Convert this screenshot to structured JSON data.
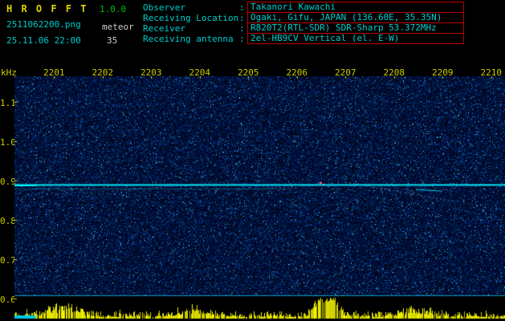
{
  "app": {
    "title": "H R O F F T",
    "version": "1.0.0",
    "filename": "2511062200.png",
    "mode": "meteor",
    "datetime": "25.11.06 22:00",
    "count": "35"
  },
  "info": {
    "rows": [
      {
        "label": "Observer",
        "value": "Takanori Kawachi"
      },
      {
        "label": "Receiving Location",
        "value": "Ogaki, Gifu, JAPAN (136.60E, 35.35N)"
      },
      {
        "label": "Receiver",
        "value": "R820T2(RTL-SDR) SDR-Sharp 53.372MHz"
      },
      {
        "label": "Receiving antenna",
        "value": "2el-HB9CV Vertical (el. E-W)"
      }
    ]
  },
  "axes": {
    "unit_label": "kHz",
    "time_labels": [
      "2201",
      "2202",
      "2203",
      "2204",
      "2205",
      "2206",
      "2207",
      "2208",
      "2209",
      "2210"
    ],
    "freq_labels": [
      "1.1",
      "1.0",
      "0.9",
      "0.8",
      "0.7",
      "0.6"
    ]
  },
  "colors": {
    "title_yellow": "#d8d800",
    "version_green": "#00bb00",
    "cyan": "#00cccc",
    "white": "#cccccc",
    "box_red": "#bb0000",
    "axis_yellow": "#cccc00",
    "carrier_cyan": "#00ffff",
    "carrier_glow": "#00d8ff",
    "bottom_line_cyan": "#00c0e0",
    "bar_yellow": "#e0e000",
    "event_pink": "#ff6f9f",
    "streak_blue": "#8fc0ff"
  }
}
